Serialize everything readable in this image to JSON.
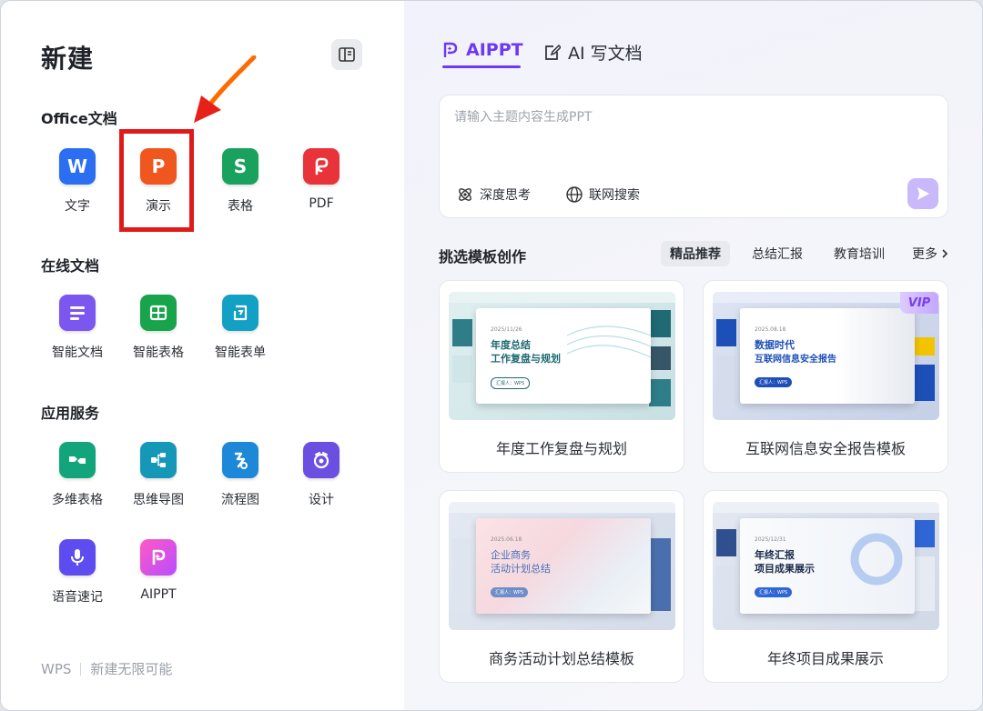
{
  "left": {
    "title": "新建",
    "sections": {
      "office": {
        "title": "Office文档",
        "items": [
          {
            "label": "文字",
            "icon": "word-doc-icon",
            "glyph": "W",
            "color": "#2b6ef2"
          },
          {
            "label": "演示",
            "icon": "presentation-icon",
            "glyph": "P",
            "color": "#f0571f"
          },
          {
            "label": "表格",
            "icon": "spreadsheet-icon",
            "glyph": "S",
            "color": "#19a25d"
          },
          {
            "label": "PDF",
            "icon": "pdf-icon",
            "glyph": "",
            "color": "#e8333a"
          }
        ]
      },
      "online": {
        "title": "在线文档",
        "items": [
          {
            "label": "智能文档",
            "icon": "smart-doc-icon",
            "color": "#7b57f0"
          },
          {
            "label": "智能表格",
            "icon": "smart-sheet-icon",
            "color": "#17a44b"
          },
          {
            "label": "智能表单",
            "icon": "smart-form-icon",
            "color": "#12a0c4"
          }
        ]
      },
      "services": {
        "title": "应用服务",
        "items": [
          {
            "label": "多维表格",
            "icon": "multi-table-icon",
            "color": "#12a47a"
          },
          {
            "label": "思维导图",
            "icon": "mind-map-icon",
            "color": "#1597b8"
          },
          {
            "label": "流程图",
            "icon": "flowchart-icon",
            "color": "#1e88d8"
          },
          {
            "label": "设计",
            "icon": "design-icon",
            "color": "#6a4fe0"
          },
          {
            "label": "语音速记",
            "icon": "voice-note-icon",
            "color": "#5d4df0"
          },
          {
            "label": "AIPPT",
            "icon": "aippt-icon",
            "color": "#e24ad8"
          }
        ]
      }
    },
    "footer": {
      "brand": "WPS",
      "slogan": "新建无限可能"
    }
  },
  "right": {
    "tabs": [
      {
        "label": "AIPPT",
        "active": true,
        "icon": "aippt-tab-icon"
      },
      {
        "label": "AI 写文档",
        "active": false,
        "icon": "ai-write-icon"
      }
    ],
    "prompt": {
      "placeholder": "请输入主题内容生成PPT",
      "chips": [
        {
          "label": "深度思考",
          "icon": "deep-think-icon"
        },
        {
          "label": "联网搜索",
          "icon": "globe-icon"
        }
      ]
    },
    "templates": {
      "title": "挑选模板创作",
      "filters": [
        {
          "label": "精品推荐",
          "active": true
        },
        {
          "label": "总结汇报",
          "active": false
        },
        {
          "label": "教育培训",
          "active": false
        },
        {
          "label": "更多",
          "active": false
        }
      ],
      "cards": [
        {
          "caption": "年度工作复盘与规划",
          "date": "2025/11/26",
          "line1": "年度总结",
          "line2": "工作复盘与规划",
          "by": "汇报人：WPS",
          "vip": false
        },
        {
          "caption": "互联网信息安全报告模板",
          "date": "2025.08.18",
          "line1": "数据时代",
          "line2": "互联网信息安全报告",
          "by": "汇报人：WPS",
          "vip": true,
          "vip_label": "VIP"
        },
        {
          "caption": "商务活动计划总结模板",
          "date": "2025.06.18",
          "line1": "企业商务",
          "line2": "活动计划总结",
          "by": "汇报人：WPS",
          "vip": false
        },
        {
          "caption": "年终项目成果展示",
          "date": "2025/12/31",
          "line1": "年终汇报",
          "line2": "项目成果展示",
          "by": "汇报人：WPS",
          "vip": false
        }
      ]
    }
  }
}
